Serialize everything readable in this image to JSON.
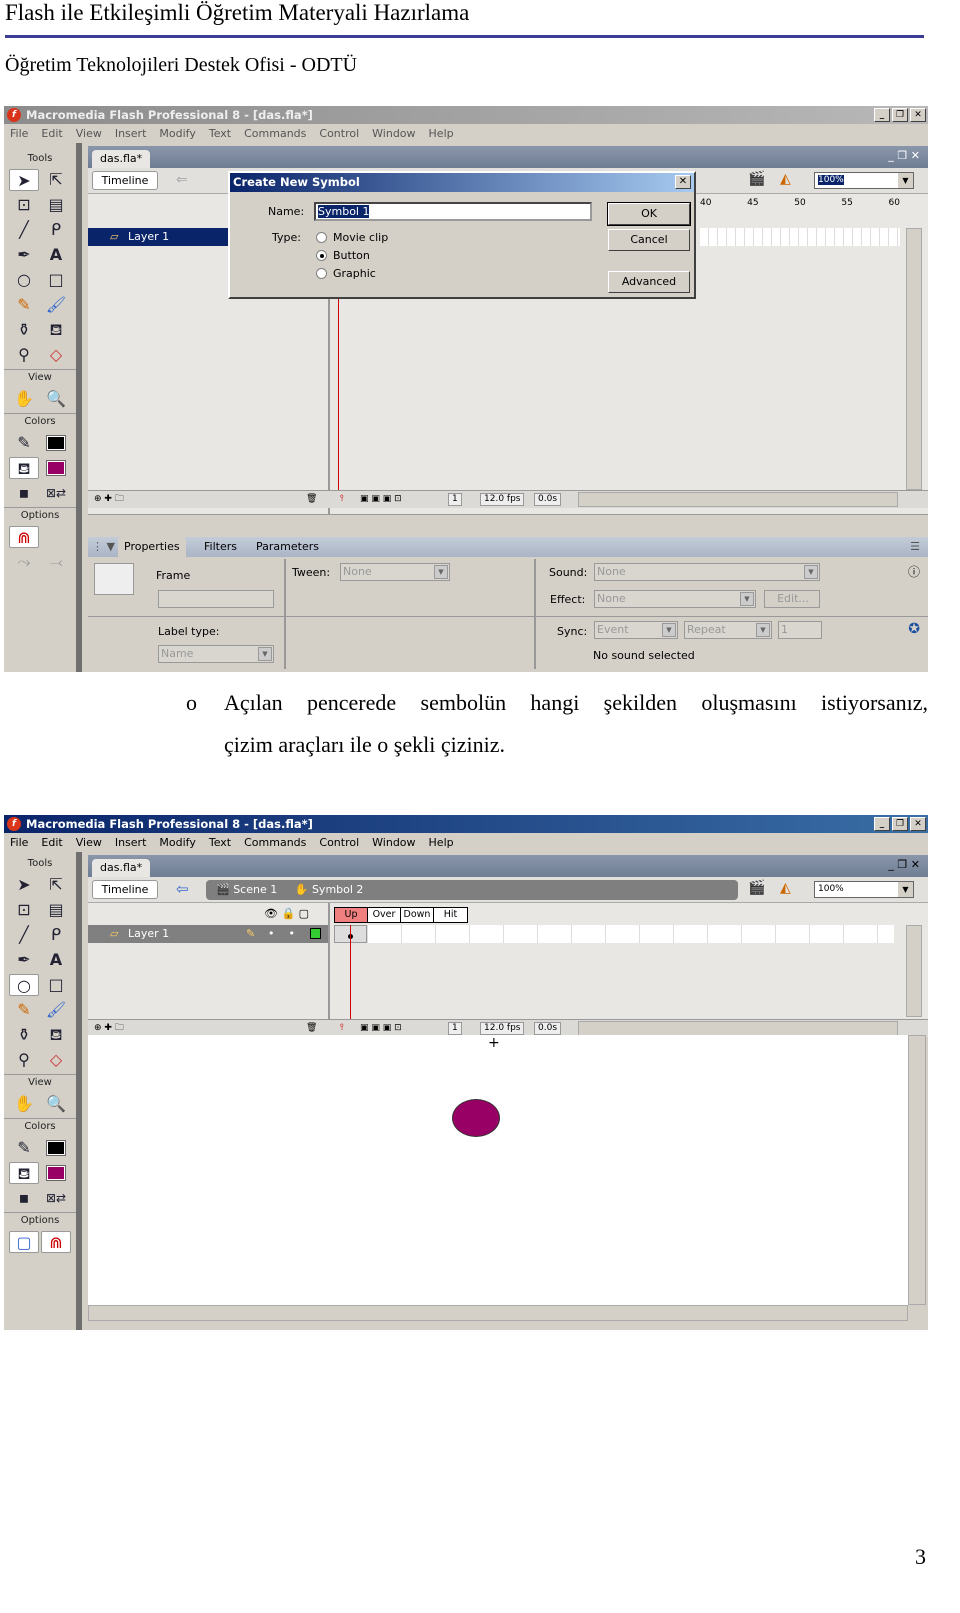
{
  "header": {
    "title": "Flash ile Etkileşimli Öğretim Materyali Hazırlama",
    "subtitle": "Öğretim Teknolojileri Destek Ofisi - ODTÜ"
  },
  "app": {
    "window_title": "Macromedia Flash Professional 8 - [das.fla*]",
    "menu": [
      "File",
      "Edit",
      "View",
      "Insert",
      "Modify",
      "Text",
      "Commands",
      "Control",
      "Window",
      "Help"
    ],
    "tools_label": "Tools",
    "view_label": "View",
    "colors_label": "Colors",
    "options_label": "Options",
    "doc_tab": "das.fla*",
    "timeline_button": "Timeline",
    "layer_name": "Layer 1",
    "zoom": "100%",
    "stroke_color": "#000000",
    "fill_color": "#990066"
  },
  "screenshot1": {
    "dialog": {
      "title": "Create New Symbol",
      "name_label": "Name:",
      "name_value": "Symbol 1",
      "type_label": "Type:",
      "types": [
        "Movie clip",
        "Button",
        "Graphic"
      ],
      "selected_type": "Button",
      "ok": "OK",
      "cancel": "Cancel",
      "advanced": "Advanced"
    },
    "frame_numbers": [
      "40",
      "45",
      "50",
      "55",
      "60"
    ],
    "timeline_status": {
      "frame": "1",
      "fps": "12.0 fps",
      "time": "0.0s"
    },
    "properties": {
      "tabs": [
        "Properties",
        "Filters",
        "Parameters"
      ],
      "frame_label": "Frame",
      "tween_label": "Tween:",
      "tween_value": "None",
      "sound_label": "Sound:",
      "sound_value": "None",
      "effect_label": "Effect:",
      "effect_value": "None",
      "edit_button": "Edit...",
      "label_type_label": "Label type:",
      "label_type_value": "Name",
      "sync_label": "Sync:",
      "sync_value": "Event",
      "repeat_value": "Repeat",
      "repeat_count": "1",
      "no_sound": "No sound selected"
    }
  },
  "instruction": {
    "bullet": "o",
    "line1": "Açılan pencerede sembolün hangi şekilden oluşmasını istiyorsanız,",
    "line2": "çizim araçları ile o şekli çiziniz."
  },
  "screenshot2": {
    "breadcrumb": [
      "Scene 1",
      "Symbol 2"
    ],
    "button_states": [
      "Up",
      "Over",
      "Down",
      "Hit"
    ],
    "timeline_status": {
      "frame": "1",
      "fps": "12.0 fps",
      "time": "0.0s"
    },
    "shape_color": "#990066"
  },
  "page_number": "3"
}
